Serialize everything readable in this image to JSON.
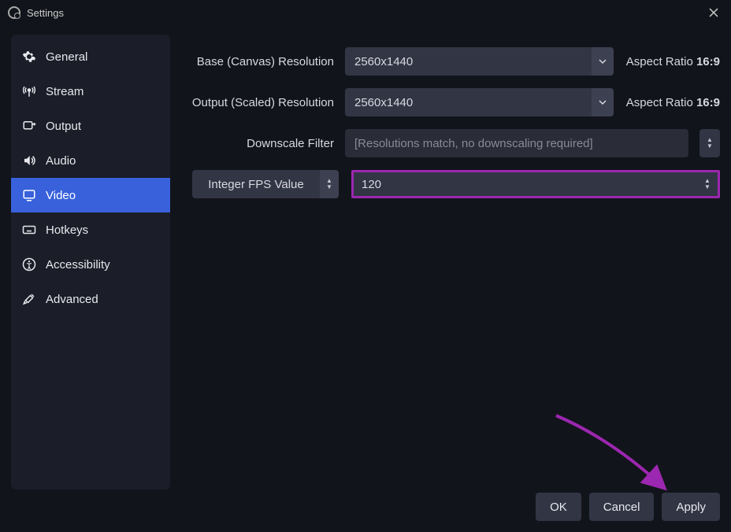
{
  "window": {
    "title": "Settings"
  },
  "sidebar": {
    "items": [
      {
        "label": "General"
      },
      {
        "label": "Stream"
      },
      {
        "label": "Output"
      },
      {
        "label": "Audio"
      },
      {
        "label": "Video"
      },
      {
        "label": "Hotkeys"
      },
      {
        "label": "Accessibility"
      },
      {
        "label": "Advanced"
      }
    ],
    "active_index": 4
  },
  "video": {
    "base_label": "Base (Canvas) Resolution",
    "base_value": "2560x1440",
    "base_aspect_label": "Aspect Ratio",
    "base_aspect_value": "16:9",
    "output_label": "Output (Scaled) Resolution",
    "output_value": "2560x1440",
    "output_aspect_label": "Aspect Ratio",
    "output_aspect_value": "16:9",
    "filter_label": "Downscale Filter",
    "filter_value": "[Resolutions match, no downscaling required]",
    "fps_type_label": "Integer FPS Value",
    "fps_value": "120"
  },
  "footer": {
    "ok": "OK",
    "cancel": "Cancel",
    "apply": "Apply"
  }
}
